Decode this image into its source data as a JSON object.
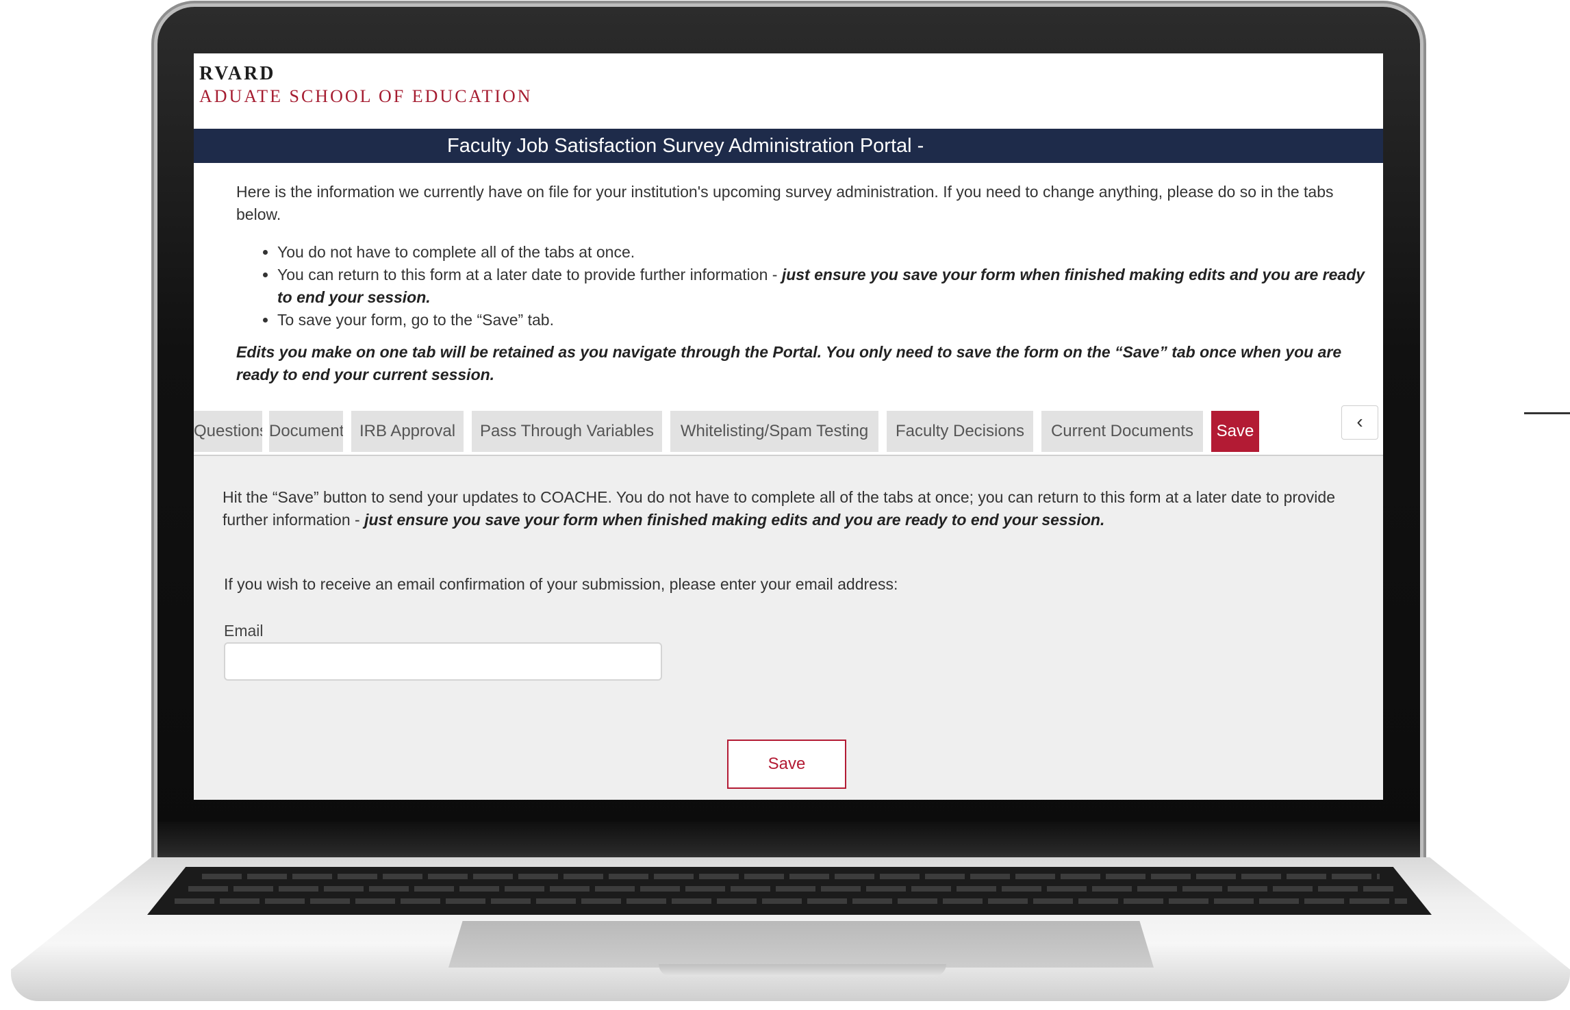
{
  "logo": {
    "line1": "RVARD",
    "line2": "ADUATE SCHOOL OF EDUCATION"
  },
  "banner": {
    "title": "Faculty Job Satisfaction Survey Administration Portal -"
  },
  "intro": {
    "paragraph": "Here is the information we currently have on file for your institution's upcoming survey administration.  If you need to change anything, please do so in the tabs below.",
    "bullets": [
      {
        "text": "You do not have to complete all of the tabs at once.",
        "emphasis": ""
      },
      {
        "text": "You can return to this form at a later date to provide further information - ",
        "emphasis": "just ensure you save your form when finished making edits and you are ready to end your session."
      },
      {
        "text": "To save your form, go to the “Save” tab.",
        "emphasis": ""
      }
    ],
    "note": "Edits you make on one tab will be retained as you navigate through the Portal. You only need to save the form on the “Save” tab once when you are ready to end your current session."
  },
  "tabs": [
    {
      "label": "Questions",
      "active": false
    },
    {
      "label": "Documents",
      "active": false
    },
    {
      "label": "IRB Approval",
      "active": false
    },
    {
      "label": "Pass Through Variables",
      "active": false
    },
    {
      "label": "Whitelisting/Spam Testing",
      "active": false
    },
    {
      "label": "Faculty Decisions",
      "active": false
    },
    {
      "label": "Current Documents",
      "active": false
    },
    {
      "label": "Save",
      "active": true
    }
  ],
  "tab_scroll_glyph": "‹",
  "save_panel": {
    "instructions": "Hit the “Save” button to send your updates to COACHE.  You do not have to complete all of the tabs at once; you can return to this form at a later date to provide further information - ",
    "instructions_emphasis": "just ensure you save your form when finished making edits and you are ready to end your session.",
    "prompt": "If you wish to receive an email confirmation of your submission, please enter your email address:",
    "email_label": "Email",
    "email_value": "",
    "email_placeholder": "",
    "save_label": "Save"
  },
  "colors": {
    "banner": "#1e2b4a",
    "accent": "#b31b34",
    "crimson_logo": "#a51c30"
  }
}
